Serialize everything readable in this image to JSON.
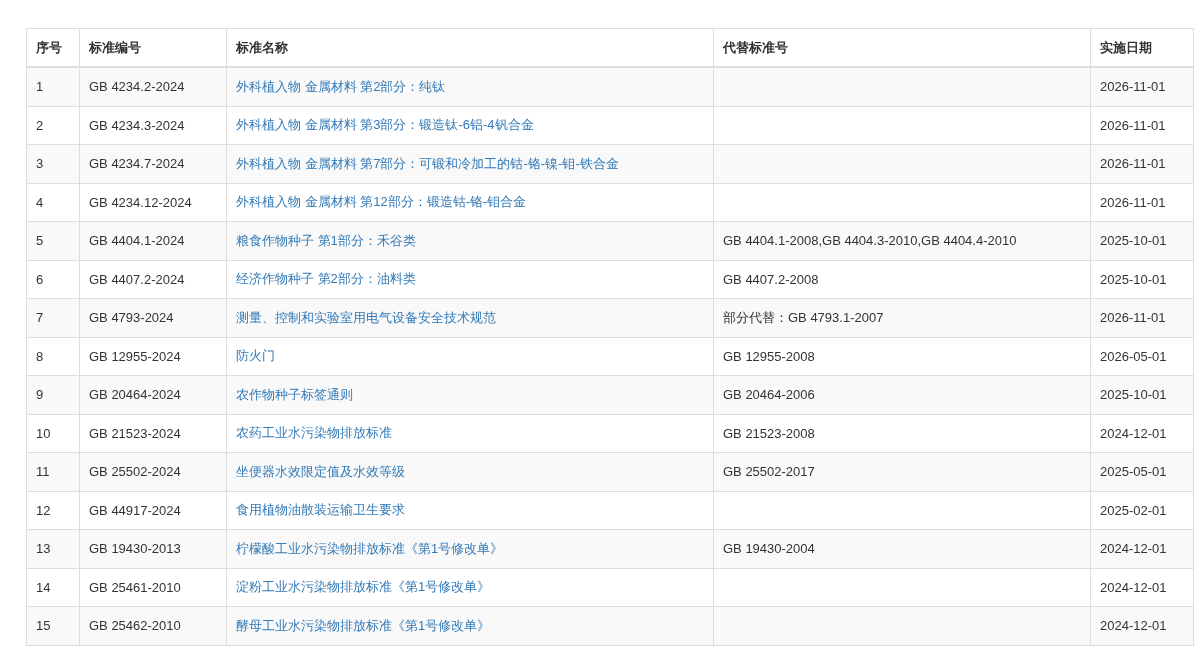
{
  "table": {
    "columns": [
      "序号",
      "标准编号",
      "标准名称",
      "代替标准号",
      "实施日期"
    ],
    "rows": [
      {
        "index": "1",
        "code": "GB 4234.2-2024",
        "name": "外科植入物 金属材料 第2部分：纯钛",
        "replaces": "",
        "date": "2026-11-01"
      },
      {
        "index": "2",
        "code": "GB 4234.3-2024",
        "name": "外科植入物 金属材料 第3部分：锻造钛-6铝-4钒合金",
        "replaces": "",
        "date": "2026-11-01"
      },
      {
        "index": "3",
        "code": "GB 4234.7-2024",
        "name": "外科植入物 金属材料 第7部分：可锻和冷加工的钴-铬-镍-钼-铁合金",
        "replaces": "",
        "date": "2026-11-01"
      },
      {
        "index": "4",
        "code": "GB 4234.12-2024",
        "name": "外科植入物 金属材料 第12部分：锻造钴-铬-钼合金",
        "replaces": "",
        "date": "2026-11-01"
      },
      {
        "index": "5",
        "code": "GB 4404.1-2024",
        "name": "粮食作物种子 第1部分：禾谷类",
        "replaces": "GB 4404.1-2008,GB 4404.3-2010,GB 4404.4-2010",
        "date": "2025-10-01"
      },
      {
        "index": "6",
        "code": "GB 4407.2-2024",
        "name": "经济作物种子 第2部分：油料类",
        "replaces": "GB 4407.2-2008",
        "date": "2025-10-01"
      },
      {
        "index": "7",
        "code": "GB 4793-2024",
        "name": "测量、控制和实验室用电气设备安全技术规范",
        "replaces": "部分代替：GB 4793.1-2007",
        "date": "2026-11-01"
      },
      {
        "index": "8",
        "code": "GB 12955-2024",
        "name": "防火门",
        "replaces": "GB 12955-2008",
        "date": "2026-05-01"
      },
      {
        "index": "9",
        "code": "GB 20464-2024",
        "name": "农作物种子标签通则",
        "replaces": "GB 20464-2006",
        "date": "2025-10-01"
      },
      {
        "index": "10",
        "code": "GB 21523-2024",
        "name": "农药工业水污染物排放标准",
        "replaces": "GB 21523-2008",
        "date": "2024-12-01"
      },
      {
        "index": "11",
        "code": "GB 25502-2024",
        "name": "坐便器水效限定值及水效等级",
        "replaces": "GB 25502-2017",
        "date": "2025-05-01"
      },
      {
        "index": "12",
        "code": "GB 44917-2024",
        "name": "食用植物油散装运输卫生要求",
        "replaces": "",
        "date": "2025-02-01"
      },
      {
        "index": "13",
        "code": "GB 19430-2013",
        "name": "柠檬酸工业水污染物排放标准《第1号修改单》",
        "replaces": "GB 19430-2004",
        "date": "2024-12-01"
      },
      {
        "index": "14",
        "code": "GB 25461-2010",
        "name": "淀粉工业水污染物排放标准《第1号修改单》",
        "replaces": "",
        "date": "2024-12-01"
      },
      {
        "index": "15",
        "code": "GB 25462-2010",
        "name": "酵母工业水污染物排放标准《第1号修改单》",
        "replaces": "",
        "date": "2024-12-01"
      }
    ]
  }
}
